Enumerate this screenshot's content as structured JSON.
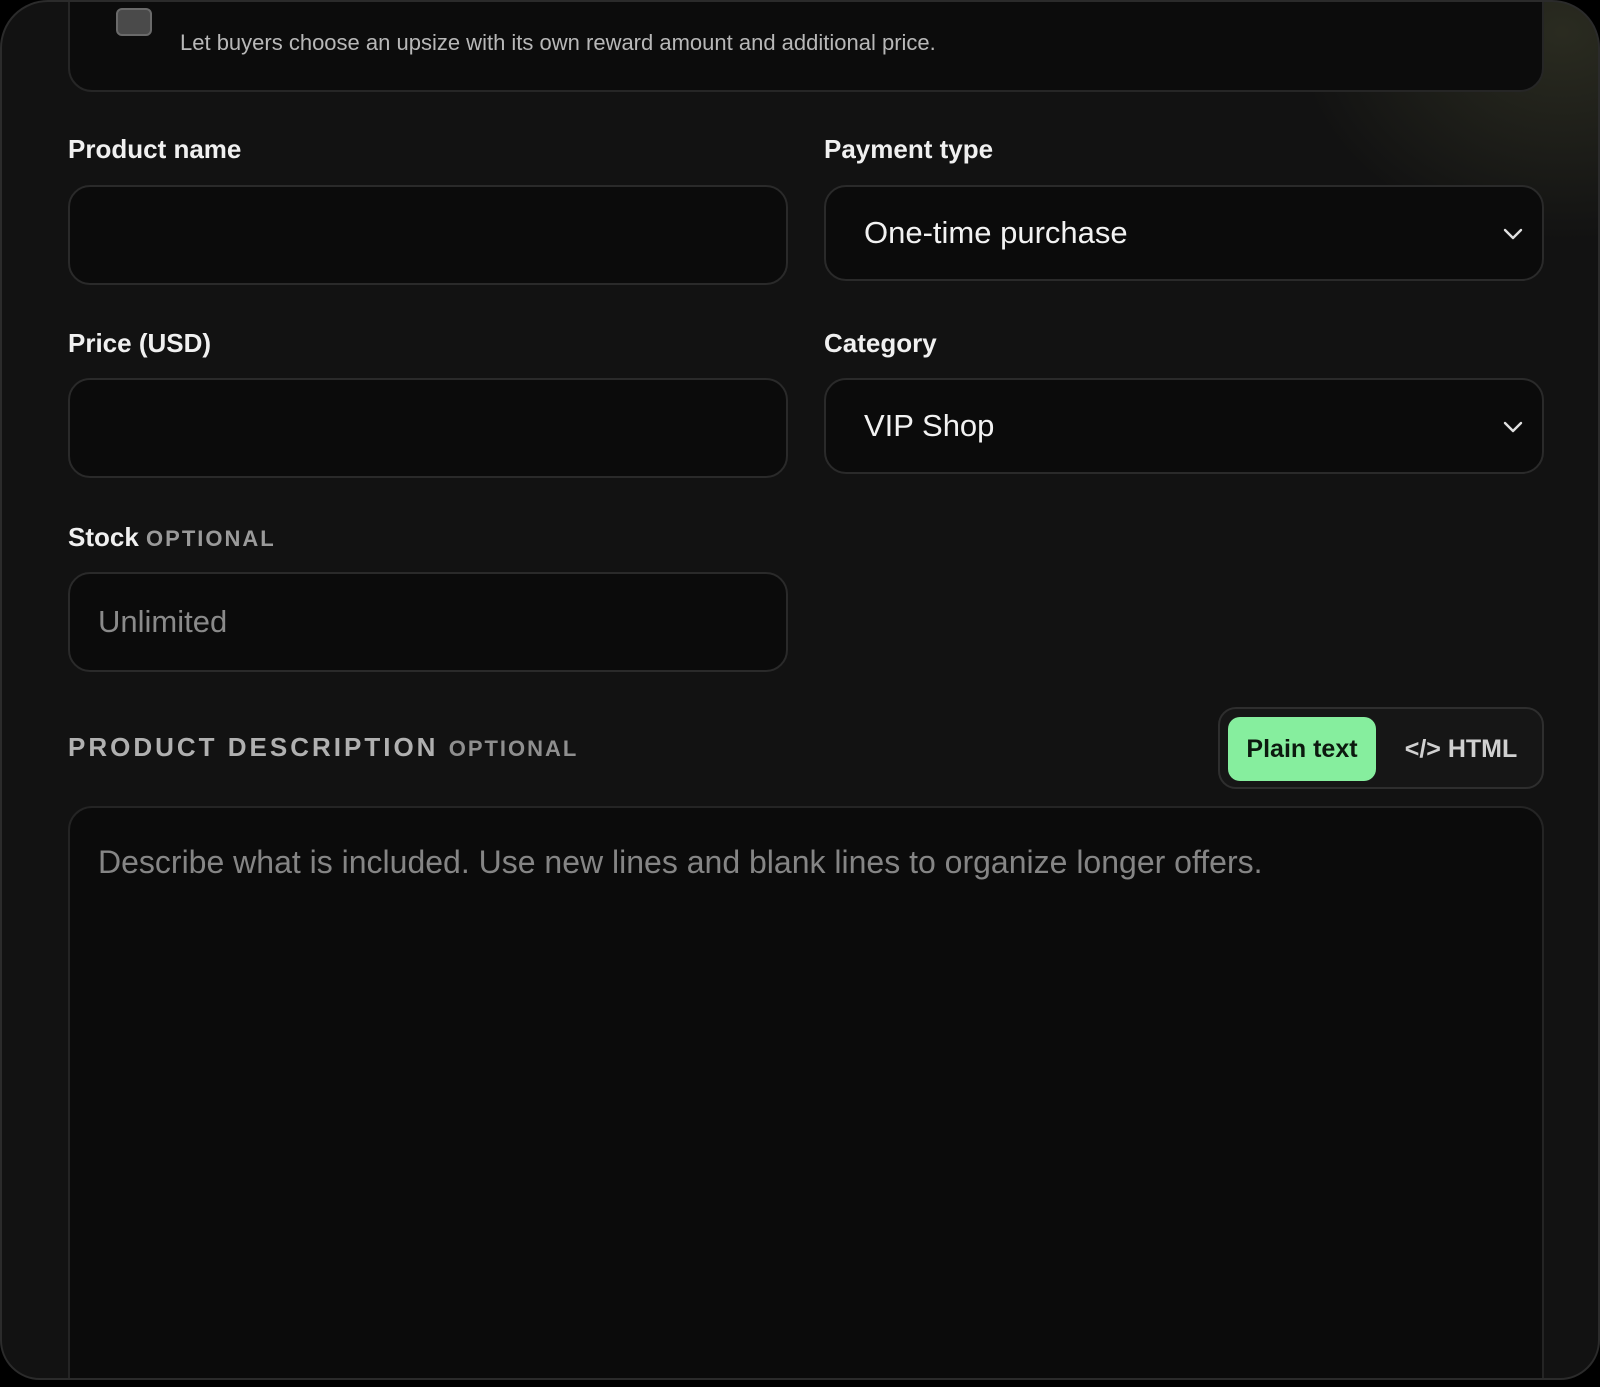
{
  "upsize": {
    "description": "Let buyers choose an upsize with its own reward amount and additional price."
  },
  "form": {
    "product_name": {
      "label": "Product name",
      "value": "",
      "placeholder": ""
    },
    "payment_type": {
      "label": "Payment type",
      "selected": "One-time purchase"
    },
    "price": {
      "label": "Price (USD)",
      "value": "",
      "placeholder": ""
    },
    "category": {
      "label": "Category",
      "selected": "VIP Shop"
    },
    "stock": {
      "label": "Stock",
      "optional": "OPTIONAL",
      "value": "",
      "placeholder": "Unlimited"
    }
  },
  "description": {
    "label": "PRODUCT DESCRIPTION",
    "optional": "OPTIONAL",
    "modes": {
      "plain": "Plain text",
      "html": "</> HTML",
      "active": "plain"
    },
    "value": "",
    "placeholder": "Describe what is included. Use new lines and blank lines to organize longer offers."
  },
  "colors": {
    "accent": "#86ee9e",
    "background": "#121212",
    "field": "#0b0b0b"
  }
}
